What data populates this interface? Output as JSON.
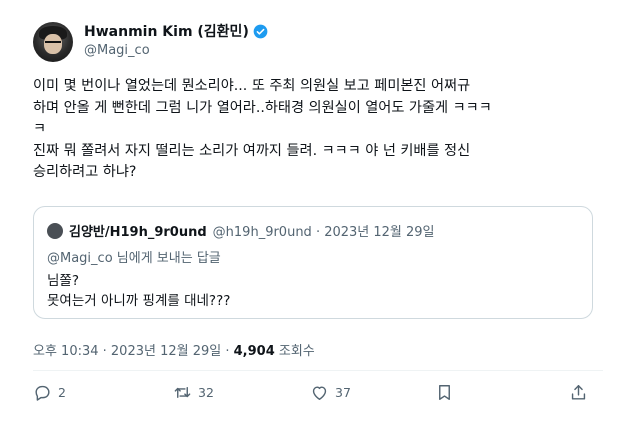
{
  "author": {
    "display_name": "Hwanmin Kim (김환민)",
    "handle": "@Magi_co",
    "verified_color": "#1d9bf0"
  },
  "tweet": {
    "line1": "이미 몇 번이나 열었는데 뭔소리야... 또 주최 의원실 보고 페미본진 어쩌규",
    "line2": "하며 안올 게 뻔한데 그럼 니가 열어라..하태경 의원실이 열어도 가줄게 ㅋㅋㅋ",
    "line3": "ㅋ",
    "line4": "진짜 뭐 쫄려서 자지 떨리는 소리가 여까지 들려. ㅋㅋㅋ 야 넌 키배를 정신",
    "line5": "승리하려고 하냐?"
  },
  "quote": {
    "name": "김양반/H19h_9r0und",
    "meta": "@h19h_9r0und · 2023년 12월 29일",
    "reply_mention": "@Magi_co",
    "reply_suffix": " 님에게 보내는 답글",
    "text_line1": "님쫄?",
    "text_line2": "못여는거 아니까 핑계를 대네???"
  },
  "timestamp": {
    "time_date": "오후 10:34 · 2023년 12월 29일 · ",
    "views_count": "4,904",
    "views_label": " 조회수"
  },
  "actions": {
    "reply_count": "2",
    "retweet_count": "32",
    "like_count": "37",
    "icons": [
      "reply-icon",
      "retweet-icon",
      "like-icon",
      "bookmark-icon",
      "share-icon"
    ]
  },
  "colors": {
    "text_primary": "#0f1419",
    "text_secondary": "#536471",
    "border": "#cfd9de"
  }
}
